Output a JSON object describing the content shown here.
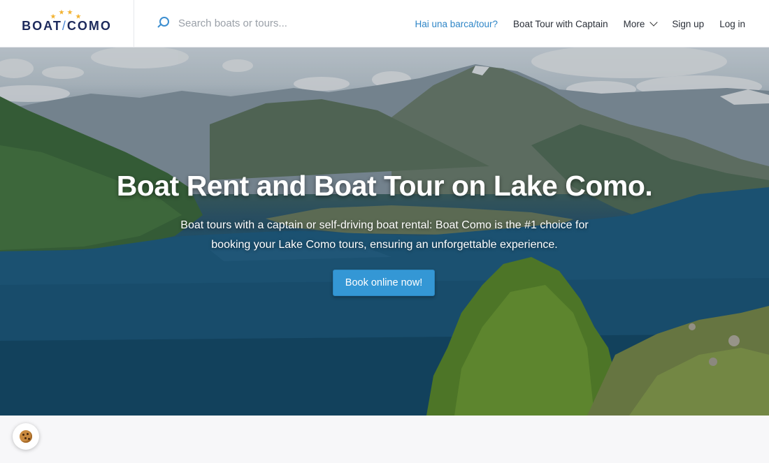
{
  "header": {
    "logo_text_left": "BOAT",
    "logo_text_right": "COMO",
    "search_placeholder": "Search boats or tours...",
    "nav": {
      "owner_link": "Hai una barca/tour?",
      "captain_link": "Boat Tour with Captain",
      "more": "More",
      "signup": "Sign up",
      "login": "Log in"
    }
  },
  "hero": {
    "title": "Boat Rent and Boat Tour on Lake Como.",
    "subtitle": "Boat tours with a captain or self-driving boat rental: Boat Como is the #1 choice for booking your Lake Como tours, ensuring an unforgettable experience.",
    "cta_label": "Book online now!"
  },
  "colors": {
    "brand_navy": "#1d2a5c",
    "accent_blue": "#3497d5",
    "link_blue": "#2f86c7",
    "star_gold": "#f2b230"
  },
  "icons": {
    "search": "search-icon",
    "more": "chevron-down-icon",
    "cookie": "cookie-icon"
  }
}
